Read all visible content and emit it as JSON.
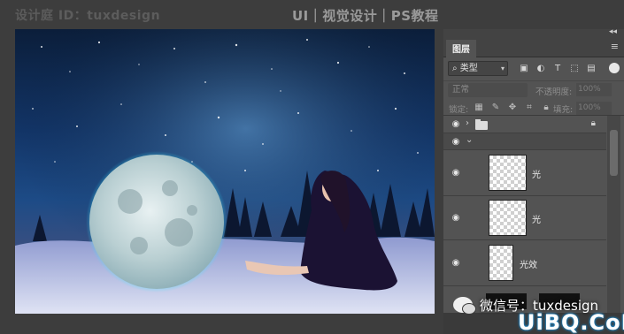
{
  "watermark": {
    "top_left": "设计庭 ID：tuxdesign",
    "top_center": "UI｜视觉设计｜PS教程",
    "wechat": "微信号：tuxdesign",
    "site": "UiBQ.CoM"
  },
  "layers_panel": {
    "tab": "图层",
    "filter": {
      "selected": "类型"
    },
    "blend_mode": "正常",
    "opacity_label": "不透明度:",
    "opacity_value": "100%",
    "lock_label": "锁定:",
    "fill_label": "填充:",
    "fill_value": "100%",
    "layers": [
      {
        "type": "group",
        "visible": true,
        "expanded": false,
        "locked": true
      },
      {
        "type": "group",
        "visible": true,
        "expanded": true
      },
      {
        "type": "layer",
        "name": "光",
        "visible": true
      },
      {
        "type": "layer",
        "name": "光",
        "visible": true
      },
      {
        "type": "layer",
        "name": "光效",
        "visible": true
      }
    ]
  },
  "colors": {
    "app_bg": "#3d3d3d",
    "panel_bg": "#535353",
    "moon_glow": "#35e3ff"
  }
}
